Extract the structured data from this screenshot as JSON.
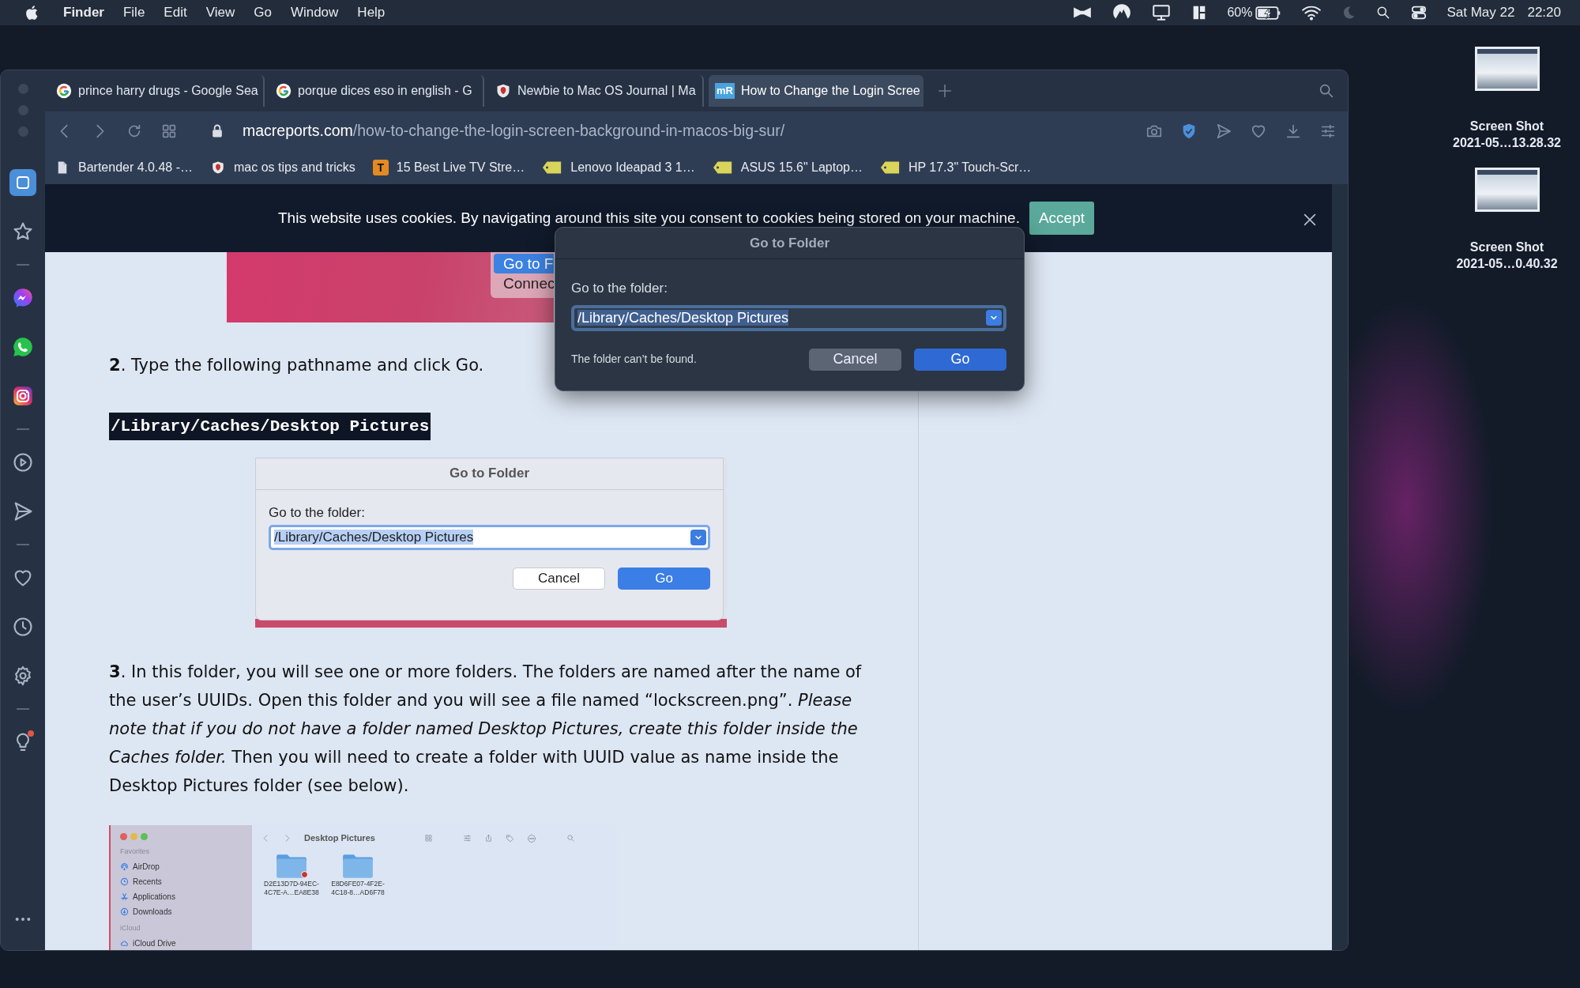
{
  "menu_bar": {
    "app": "Finder",
    "menus": [
      "File",
      "Edit",
      "View",
      "Go",
      "Window",
      "Help"
    ],
    "battery": "60%",
    "date": "Sat May 22",
    "time": "22:20"
  },
  "desktop_icons": [
    {
      "title": "Screen Shot",
      "subtitle": "2021-05…13.28.32"
    },
    {
      "title": "Screen Shot",
      "subtitle": "2021-05…0.40.32"
    }
  ],
  "browser": {
    "sidebar": {
      "groups": [
        [
          {
            "kind": "home",
            "selected": true,
            "badge": false
          },
          {
            "kind": "star",
            "selected": false,
            "badge": false
          }
        ],
        [
          {
            "kind": "messenger",
            "selected": false,
            "badge": false
          },
          {
            "kind": "whatsapp",
            "selected": false,
            "badge": false
          },
          {
            "kind": "instagram",
            "selected": false,
            "badge": false
          }
        ],
        [
          {
            "kind": "play",
            "selected": false,
            "badge": false
          },
          {
            "kind": "send",
            "selected": false,
            "badge": false
          }
        ],
        [
          {
            "kind": "heart",
            "selected": false,
            "badge": false
          },
          {
            "kind": "clock",
            "selected": false,
            "badge": false
          },
          {
            "kind": "gear",
            "selected": false,
            "badge": false
          }
        ],
        [
          {
            "kind": "bulb",
            "selected": false,
            "badge": true
          }
        ]
      ]
    },
    "tabs": [
      {
        "title": "prince harry drugs - Google Sea",
        "kind": "ring",
        "selected": false
      },
      {
        "title": "porque dices eso in english - G",
        "kind": "ring",
        "selected": false
      },
      {
        "title": "Newbie to Mac OS Journal | Ma",
        "kind": "shield",
        "selected": false
      },
      {
        "title": "How to Change the Login Scree",
        "kind": "text",
        "favicon_text": "mR",
        "selected": true
      }
    ],
    "url": {
      "domain": "macreports.com",
      "path": "/how-to-change-the-login-screen-background-in-macos-big-sur/"
    },
    "bookmarks": [
      {
        "label": "Bartender 4.0.48 -…",
        "kind": "page"
      },
      {
        "label": "mac os tips and tricks",
        "kind": "shield"
      },
      {
        "label": "15 Best Live TV Stre…",
        "kind": "text",
        "icon_text": "T"
      },
      {
        "label": "Lenovo Ideapad 3 1…",
        "kind": "tag"
      },
      {
        "label": "ASUS 15.6\" Laptop…",
        "kind": "tag"
      },
      {
        "label": "HP 17.3\" Touch-Scr…",
        "kind": "tag"
      }
    ]
  },
  "cookie_banner": {
    "text": "This website uses cookies. By navigating around this site you consent to cookies being stored on your machine.",
    "button": "Accept"
  },
  "article": {
    "blocks": [
      {
        "kind": "image",
        "menu": [
          {
            "label": "Go to F",
            "selected": true
          },
          {
            "label": "Connec",
            "selected": false
          }
        ]
      },
      {
        "kind": "paragraph",
        "text": "**2**. Type the following pathname and click Go."
      },
      {
        "kind": "code",
        "text": "/Library/Caches/Desktop Pictures"
      },
      {
        "kind": "dialog_shot",
        "title": "Go to Folder",
        "label": "Go to the folder:",
        "value": "/Library/Caches/Desktop Pictures",
        "text_selected": true,
        "cancel": "Cancel",
        "ok": "Go"
      },
      {
        "kind": "paragraph",
        "text": "**3**. In this folder, you will see one or more folders. The folders are named after the name of the user’s UUIDs. Open this folder and you will see a file named “lockscreen.png”. *Please note that if you do not have a folder named Desktop Pictures, create this folder inside the Caches folder.* Then you will need to create a folder with UUID value as name inside the Desktop Pictures folder (see below)."
      },
      {
        "kind": "finder_shot",
        "title": "Desktop Pictures",
        "sections": [
          {
            "heading": "Favorites",
            "items": [
              {
                "label": "AirDrop",
                "kind": "airdrop"
              },
              {
                "label": "Recents",
                "kind": "clock"
              },
              {
                "label": "Applications",
                "kind": "apps"
              },
              {
                "label": "Downloads",
                "kind": "download"
              }
            ]
          },
          {
            "heading": "iCloud",
            "items": [
              {
                "label": "iCloud Drive",
                "kind": "cloud"
              }
            ]
          }
        ],
        "folders": [
          {
            "line1": "D2E13D7D-94EC-",
            "line2": "4C7E-A…EA8E38",
            "no_access": true
          },
          {
            "line1": "E8D6FE07-4F2E-",
            "line2": "4C18-8…AD6F78",
            "no_access": false
          }
        ]
      }
    ]
  },
  "dialog": {
    "title": "Go to Folder",
    "label": "Go to the folder:",
    "value": "/Library/Caches/Desktop Pictures",
    "text_selected": true,
    "message": "The folder can’t be found.",
    "cancel": "Cancel",
    "ok": "Go"
  }
}
